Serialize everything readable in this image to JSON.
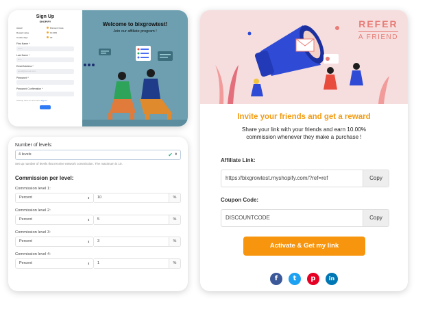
{
  "signup": {
    "title": "Sign Up",
    "store_label": "SHOPIFY",
    "details": [
      {
        "key": "Award",
        "value": "Discount Code"
      },
      {
        "key": "Reward value",
        "value": "10.00%"
      },
      {
        "key": "Cookie days",
        "value": "30"
      }
    ],
    "fields": [
      {
        "label": "First Name *",
        "placeholder": "John"
      },
      {
        "label": "Last Name *",
        "placeholder": "Doe"
      },
      {
        "label": "Email Address *",
        "placeholder": "email@domain.com"
      },
      {
        "label": "Password *",
        "placeholder": ""
      },
      {
        "label": "Password Confirmation *",
        "placeholder": ""
      }
    ],
    "footer_text": "Already have an account?",
    "footer_link": "Sign In",
    "hero_title": "Welcome to bixgrowtest!",
    "hero_subtitle": "Join our affiliate program !"
  },
  "levels": {
    "num_levels_label": "Number of levels:",
    "num_levels_value": "4 levels",
    "help_text": "Set up number of levels that receive network commission. The maximum is 10.",
    "commission_heading": "Commission per level:",
    "rows": [
      {
        "label": "Commission level 1:",
        "type": "Percent",
        "value": "10",
        "unit": "%"
      },
      {
        "label": "Commission level 2:",
        "type": "Percent",
        "value": "5",
        "unit": "%"
      },
      {
        "label": "Commission level 3:",
        "type": "Percent",
        "value": "3",
        "unit": "%"
      },
      {
        "label": "Commission level 4:",
        "type": "Percent",
        "value": "1",
        "unit": "%"
      }
    ]
  },
  "refer": {
    "badge_line1": "REFER",
    "badge_line2": "A FRIEND",
    "title": "Invite your friends and get a reward",
    "description": "Share your link with your friends and earn 10.00% commission whenever they make a purchase !",
    "affiliate_label": "Affiliate Link:",
    "affiliate_value": "https://bixgrowtest.myshopify.com/?ref=ref",
    "copy_label": "Copy",
    "coupon_label": "Coupon Code:",
    "coupon_value": "DISCOUNTCODE",
    "cta_label": "Activate & Get my link",
    "social": [
      {
        "name": "facebook-icon",
        "glyph": "f",
        "color": "#3b5998"
      },
      {
        "name": "twitter-icon",
        "glyph": "t",
        "color": "#1da1f2"
      },
      {
        "name": "pinterest-icon",
        "glyph": "p",
        "color": "#e60023"
      },
      {
        "name": "linkedin-icon",
        "glyph": "in",
        "color": "#0077b5"
      }
    ]
  }
}
